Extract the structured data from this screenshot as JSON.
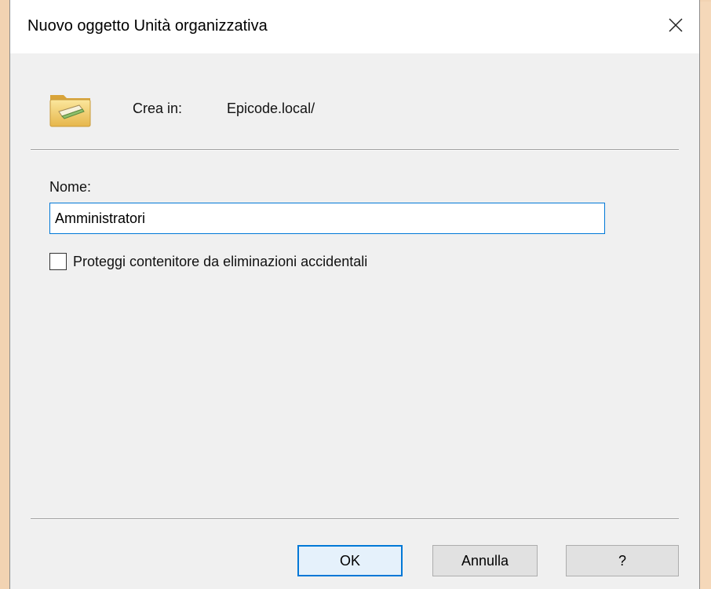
{
  "window": {
    "title": "Nuovo oggetto Unità organizzativa",
    "close_icon": "close-icon"
  },
  "create_in": {
    "icon": "organizational-unit-folder-icon",
    "label": "Crea in:",
    "value": "Epicode.local/"
  },
  "form": {
    "name_label": "Nome:",
    "name_value": "Amministratori",
    "protect_label": "Proteggi contenitore da eliminazioni accidentali",
    "protect_checked": false
  },
  "buttons": {
    "ok": "OK",
    "cancel": "Annulla",
    "help": "?"
  },
  "colors": {
    "accent": "#0078d7",
    "dialog_bg": "#f0f0f0",
    "titlebar_bg": "#ffffff",
    "outer_frame": "#f2d3b2"
  }
}
